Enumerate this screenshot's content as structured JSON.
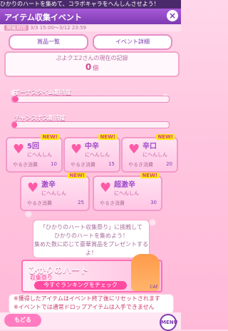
{
  "ticker": {
    "text": "ひかりのハートを集めて、コラボキャラをへんしんさせよう！"
  },
  "header": {
    "title": "アイテム収集イベント",
    "close_label": "×"
  },
  "period": {
    "label": "開催期間",
    "value": "3/3 15:00～3/12 23:59"
  },
  "tabs": {
    "prizes": "賞品一覧",
    "details": "イベント詳細"
  },
  "record": {
    "label": "ぷよクエ2さんの現在の記録",
    "value": "0",
    "unit": "個"
  },
  "gauges": {
    "bonus": {
      "title": "ボーナスタイム期待度",
      "level": 0.04
    },
    "chance": {
      "title": "チャンスボス期待度",
      "level": 0.03
    }
  },
  "cards": [
    {
      "title": "5回",
      "sub": "にへんしん",
      "badge": "NEW!",
      "count_label": "やるき消費",
      "count": "10"
    },
    {
      "title": "中辛",
      "sub": "にへんしん",
      "badge": "NEW!",
      "count_label": "やるき消費",
      "count": "15"
    },
    {
      "title": "辛口",
      "sub": "にへんしん",
      "badge": "NEW!",
      "count_label": "やるき消費",
      "count": "20"
    },
    {
      "title": "激辛",
      "sub": "にへんしん",
      "badge": "NEW!",
      "count_label": "やるき消費",
      "count": "25"
    },
    {
      "title": "超激辛",
      "sub": "にへんしん",
      "badge": "NEW!",
      "count_label": "やるき消費",
      "count": "30"
    }
  ],
  "info": [
    "「ひかりのハート収集祭り」に挑戦して",
    "ひかりのハートを集めよう！",
    "集めた数に応じて豪華賞品をプレゼントするよ！"
  ],
  "banner": {
    "title": "ひかりのハート",
    "subtitle": "収集祭り",
    "cta": "今すぐランキングをチェック",
    "logo_text": "CAF"
  },
  "notes": [
    "※獲得したアイテムはイベント終了後にリセットされます",
    "※イベントでは通常ドロップアイテムは入手できません"
  ],
  "footer": {
    "back_label": "もどる",
    "menu_label": "MENU"
  },
  "colors": {
    "accent": "#ff5aa7",
    "header": "#8b46c2"
  }
}
